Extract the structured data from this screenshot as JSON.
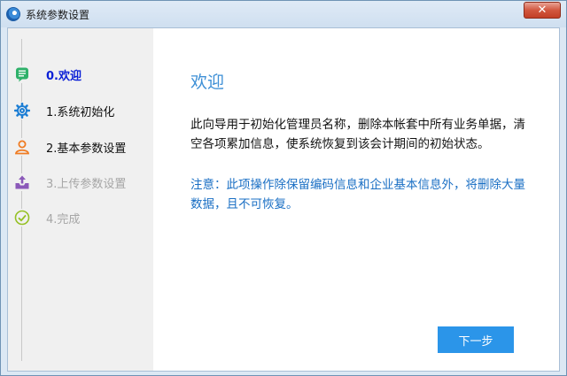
{
  "window": {
    "title": "系统参数设置",
    "close_label": "✕"
  },
  "steps": [
    {
      "label": "0.欢迎",
      "state": "active",
      "icon": "list-icon"
    },
    {
      "label": "1.系统初始化",
      "state": "normal",
      "icon": "gear-icon"
    },
    {
      "label": "2.基本参数设置",
      "state": "normal",
      "icon": "user-icon"
    },
    {
      "label": "3.上传参数设置",
      "state": "disabled",
      "icon": "upload-icon"
    },
    {
      "label": "4.完成",
      "state": "disabled",
      "icon": "check-icon"
    }
  ],
  "main": {
    "heading": "欢迎",
    "body": "此向导用于初始化管理员名称，删除本帐套中所有业务单据，清空各项累加信息，使系统恢复到该会计期间的初始状态。",
    "note": "注意：此项操作除保留编码信息和企业基本信息外，将删除大量数据，且不可恢复。",
    "next_label": "下一步"
  },
  "colors": {
    "accent": "#2b95e9",
    "active_step": "#0a1fd6",
    "heading": "#3d8fd6",
    "note": "#1a6fc4",
    "disabled": "#a6a6a6"
  }
}
